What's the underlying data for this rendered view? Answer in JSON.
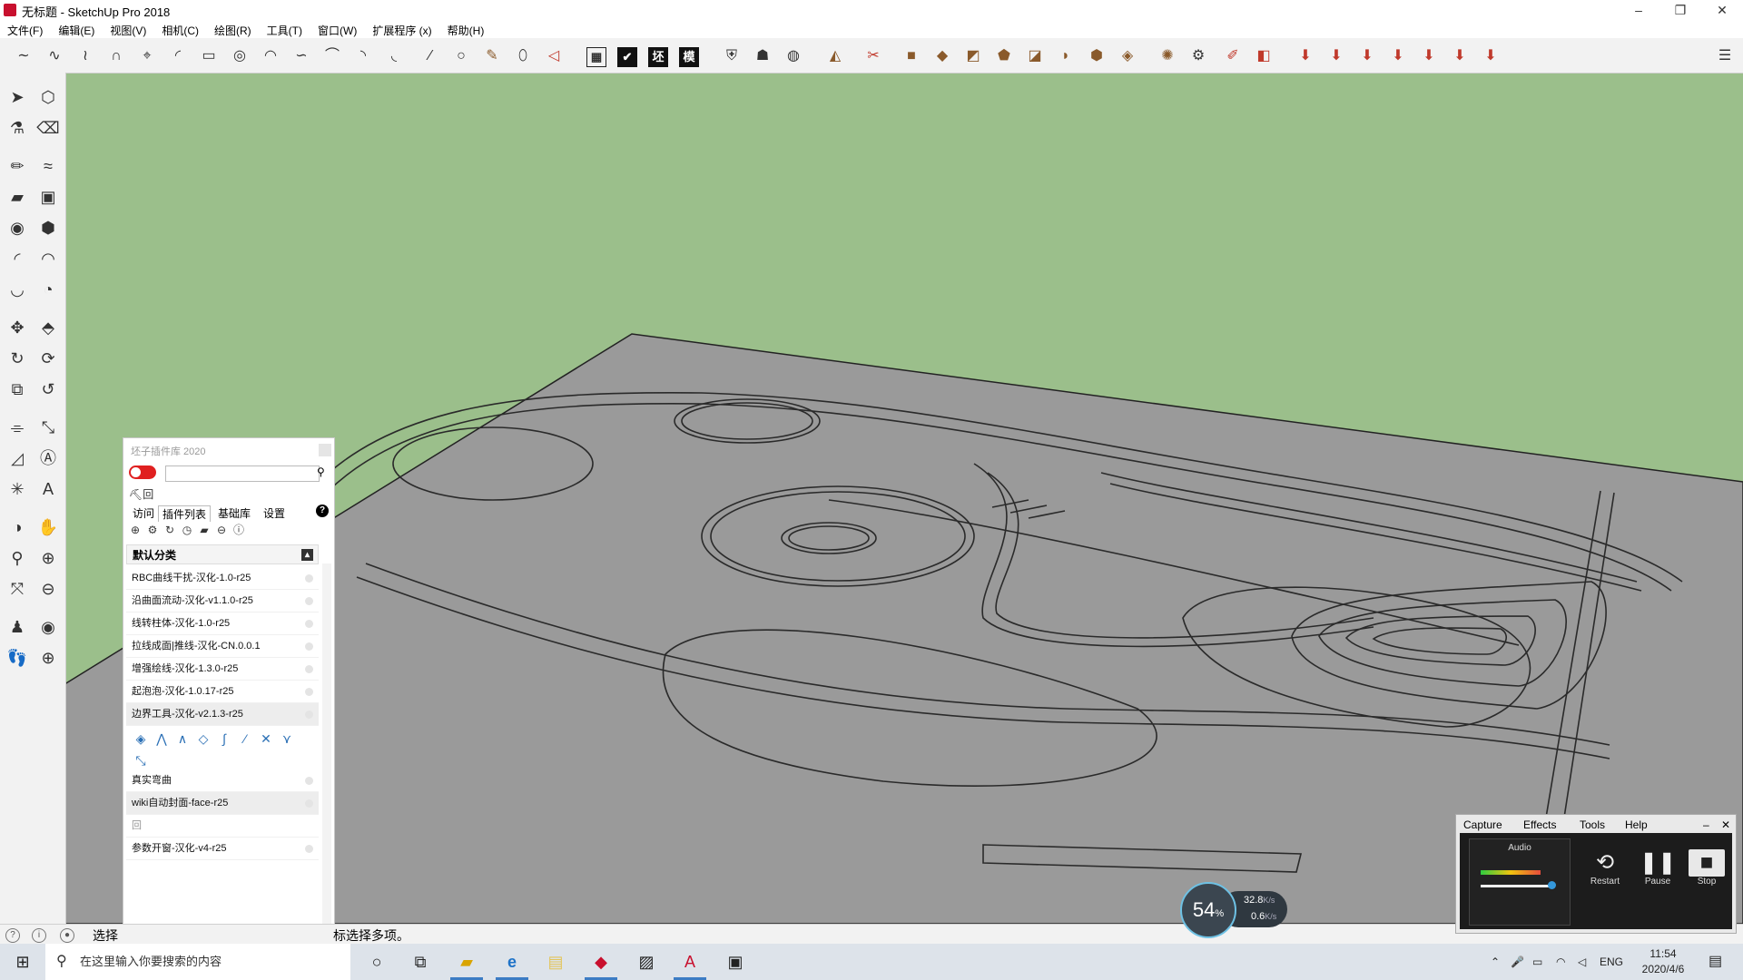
{
  "window": {
    "title": "无标题 - SketchUp Pro 2018",
    "minimize": "–",
    "restore": "❐",
    "close": "✕"
  },
  "menu": [
    "文件(F)",
    "编辑(E)",
    "视图(V)",
    "相机(C)",
    "绘图(R)",
    "工具(T)",
    "窗口(W)",
    "扩展程序 (x)",
    "帮助(H)"
  ],
  "toolbar": {
    "mode_labels": [
      "坯",
      "模"
    ],
    "icons": [
      "bezier-curve-icon",
      "spline-icon",
      "polyline-icon",
      "nurbs-icon",
      "axis-icon",
      "arc-icon",
      "rectangle-icon",
      "spiral-icon",
      "arc2-icon",
      "curve-icon",
      "bend-icon",
      "curve2-icon",
      "arc3-icon",
      "line-icon",
      "circle-icon",
      "wrench-icon",
      "ellipse-icon",
      "triangle-icon"
    ]
  },
  "plugin_panel": {
    "title": "坯子插件库 2020",
    "search_value": "",
    "extra_label": "回",
    "tabs": [
      "访问",
      "插件列表",
      "基础库",
      "设置"
    ],
    "active_tab": "插件列表",
    "help": "?",
    "category": "默认分类",
    "items": [
      "RBC曲线干扰-汉化-1.0-r25",
      "沿曲面流动-汉化-v1.1.0-r25",
      "线转柱体-汉化-1.0-r25",
      "拉线成面|推线-汉化-CN.0.0.1",
      "增强绘线-汉化-1.3.0-r25",
      "起泡泡-汉化-1.0.17-r25",
      "边界工具-汉化-v2.1.3-r25"
    ],
    "items_after": [
      "真实弯曲",
      "wiki自动封面-face-r25",
      "回",
      "参数开窗-汉化-v4-r25"
    ]
  },
  "statusbar": {
    "label": "选择",
    "hint": "标选择多项。"
  },
  "capture": {
    "menu": [
      "Capture",
      "Effects",
      "Tools",
      "Help"
    ],
    "audio_label": "Audio",
    "buttons": [
      "Restart",
      "Pause",
      "Stop"
    ],
    "audio_level": 0.8,
    "volume_level": 0.95
  },
  "net_meter": {
    "percent": "54",
    "percent_unit": "%",
    "up": "32.8",
    "down": "0.6",
    "unit": "K/s"
  },
  "taskbar": {
    "search_placeholder": "在这里输入你要搜索的内容",
    "lang": "ENG",
    "time": "11:54",
    "date": "2020/4/6"
  }
}
